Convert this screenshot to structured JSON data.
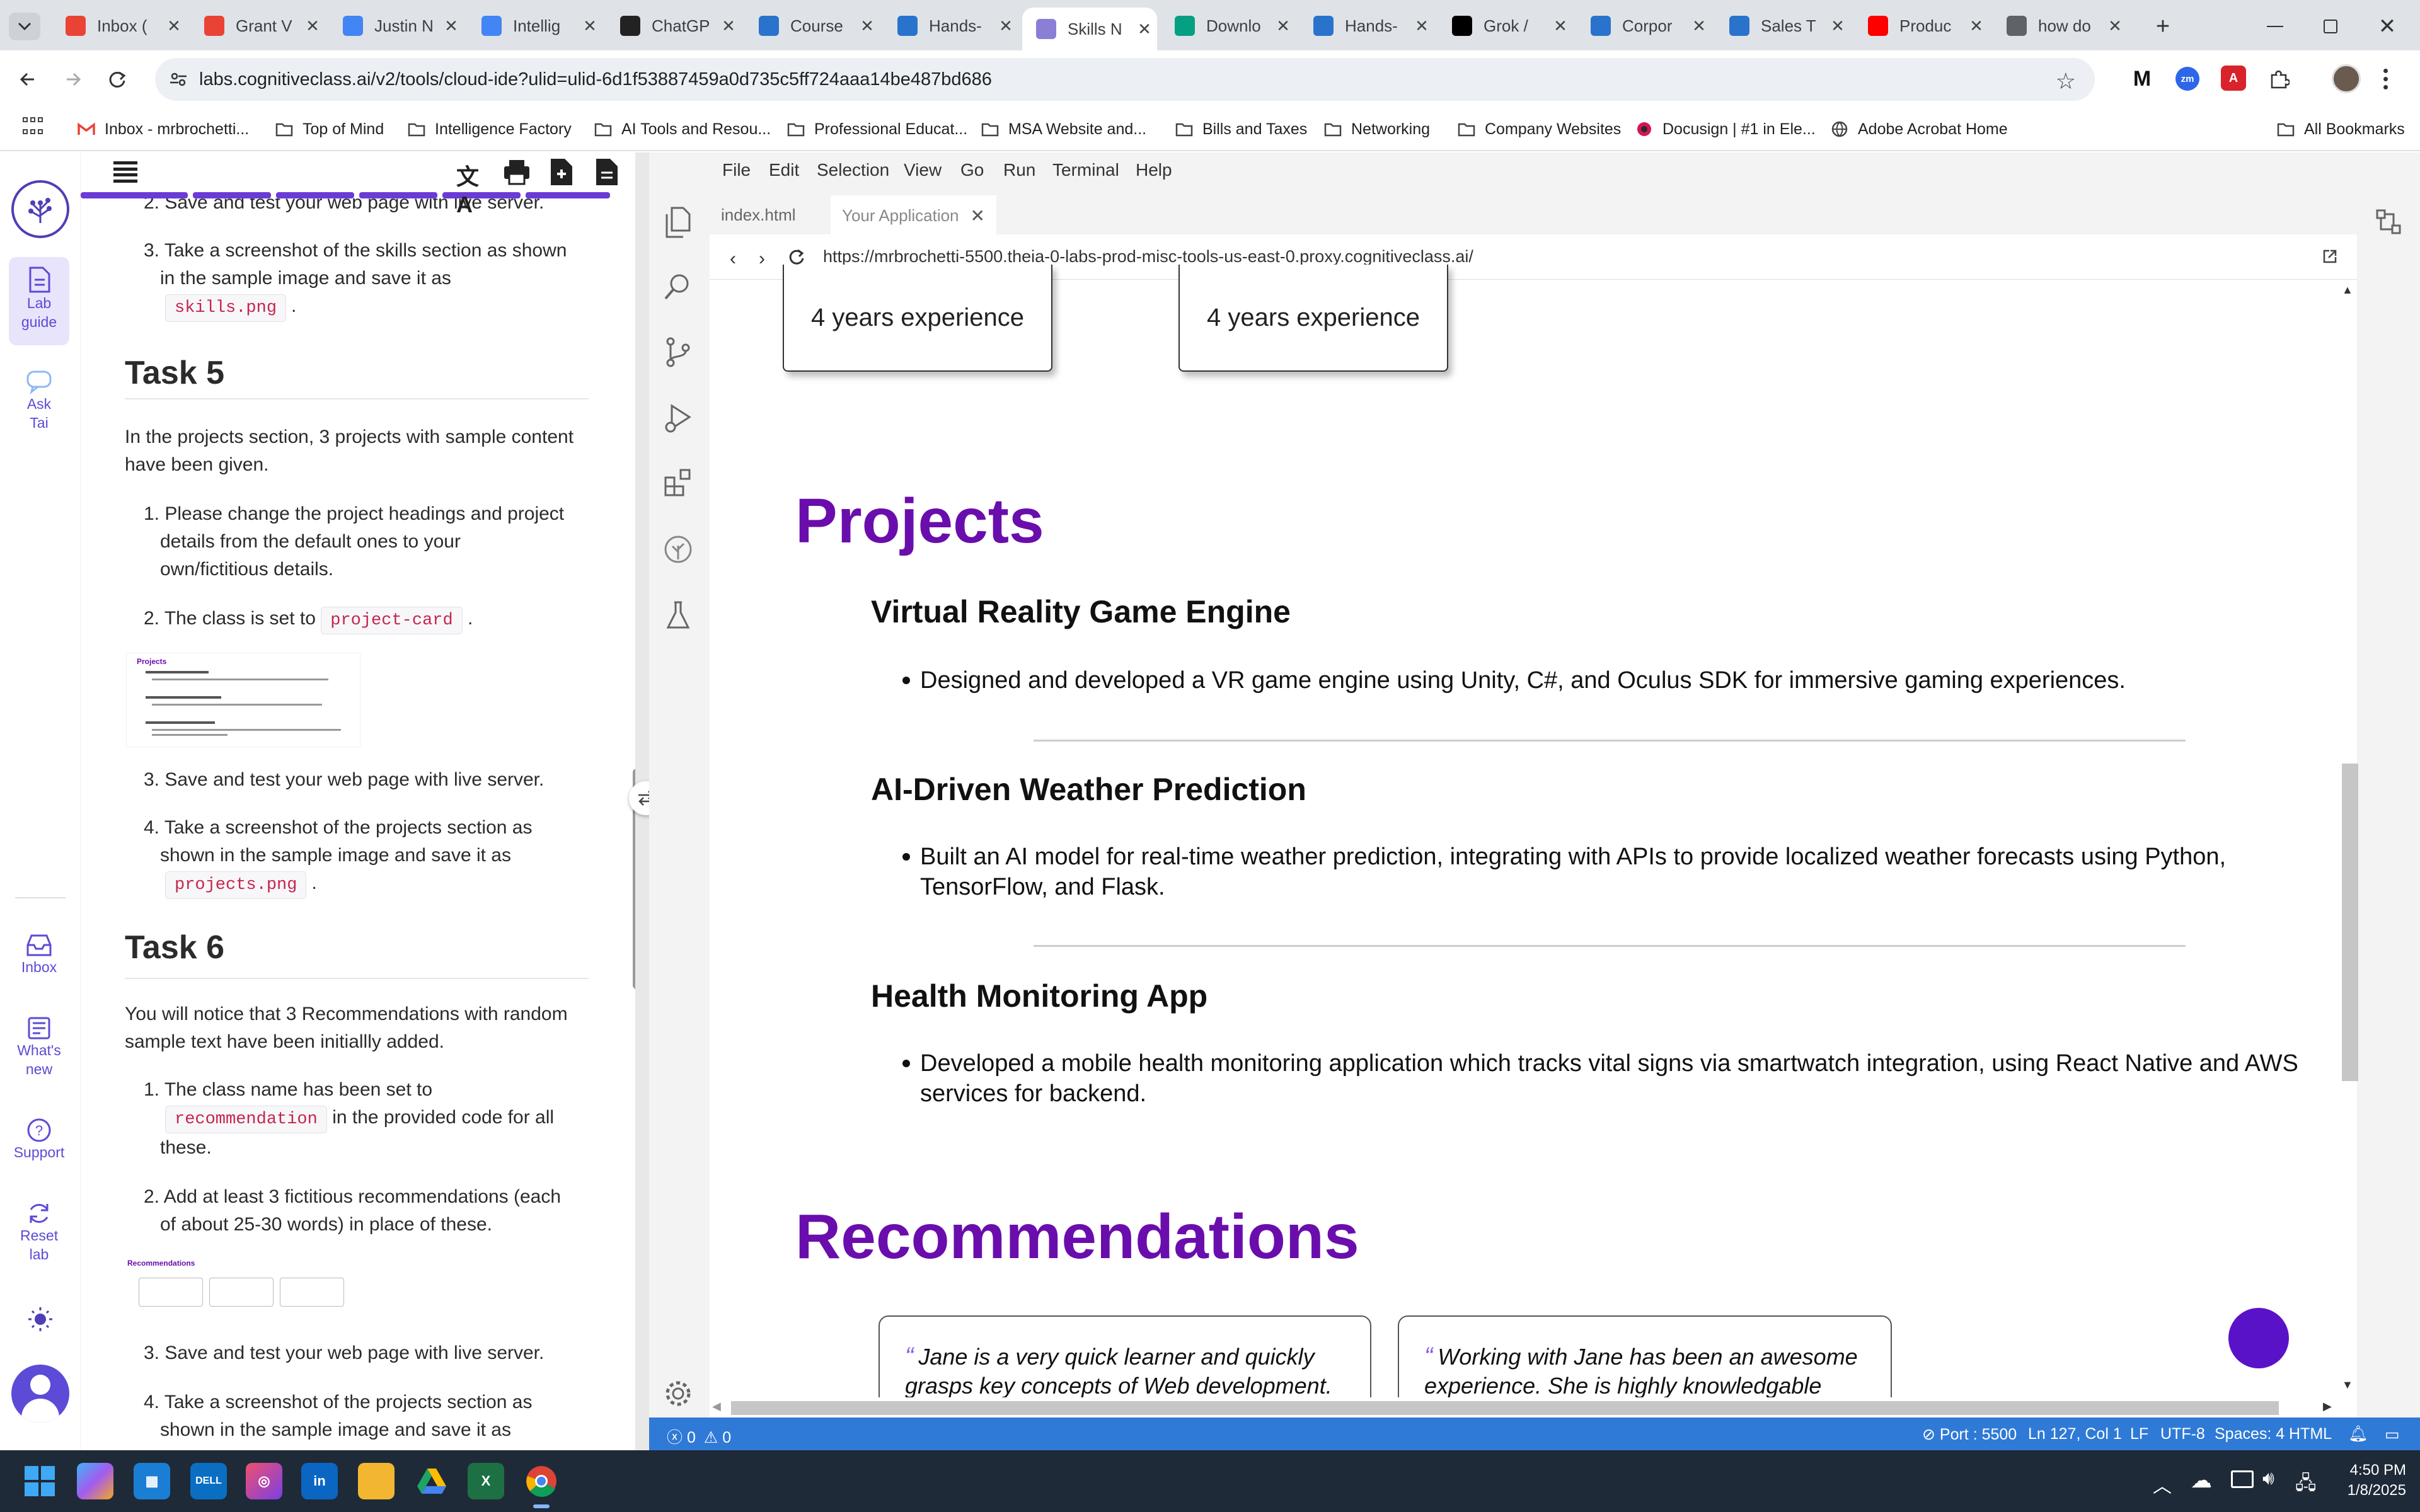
{
  "browser": {
    "tabs": [
      {
        "title": "Inbox (",
        "icon": "gmail-icon",
        "color": "#ea4335"
      },
      {
        "title": "Grant V",
        "icon": "gmail-icon",
        "color": "#ea4335"
      },
      {
        "title": "Justin N",
        "icon": "docs-icon",
        "color": "#4285f4"
      },
      {
        "title": "Intellig",
        "icon": "slides-icon",
        "color": "#4285f4"
      },
      {
        "title": "ChatGP",
        "icon": "openai-icon",
        "color": "#222222"
      },
      {
        "title": "Course",
        "icon": "coursera-icon",
        "color": "#2a73cc"
      },
      {
        "title": "Hands-",
        "icon": "coursera-icon",
        "color": "#2a73cc"
      },
      {
        "title": "Skills N",
        "icon": "theia-icon",
        "color": "#8a7fd6"
      },
      {
        "title": "Downlo",
        "icon": "pexels-icon",
        "color": "#05a081"
      },
      {
        "title": "Hands-",
        "icon": "coursera-icon",
        "color": "#2a73cc"
      },
      {
        "title": "Grok / ",
        "icon": "x-icon",
        "color": "#000000"
      },
      {
        "title": "Corpor",
        "icon": "coursera-icon",
        "color": "#2a73cc"
      },
      {
        "title": "Sales T",
        "icon": "coursera-icon",
        "color": "#2a73cc"
      },
      {
        "title": "Produc",
        "icon": "youtube-icon",
        "color": "#ff0000"
      },
      {
        "title": "how do",
        "icon": "globe-icon",
        "color": "#5f6368"
      }
    ],
    "active_tab_index": 7,
    "url": "labs.cognitiveclass.ai/v2/tools/cloud-ide?ulid=ulid-6d1f53887459a0d735c5ff724aaa14be487bd686",
    "bookmarks": [
      {
        "label": "Inbox - mrbrochetti...",
        "icon": "gmail-icon"
      },
      {
        "label": "Top of Mind",
        "icon": "folder-icon"
      },
      {
        "label": "Intelligence Factory",
        "icon": "folder-icon"
      },
      {
        "label": "AI Tools and Resou...",
        "icon": "folder-icon"
      },
      {
        "label": "Professional Educat...",
        "icon": "folder-icon"
      },
      {
        "label": "MSA Website and...",
        "icon": "folder-icon"
      },
      {
        "label": "Bills and Taxes",
        "icon": "folder-icon"
      },
      {
        "label": "Networking",
        "icon": "folder-icon"
      },
      {
        "label": "Company Websites",
        "icon": "folder-icon"
      },
      {
        "label": "Docusign | #1 in Ele...",
        "icon": "docusign-icon"
      },
      {
        "label": "Adobe Acrobat Home",
        "icon": "globe-icon"
      }
    ],
    "all_bookmarks": "All Bookmarks"
  },
  "rail": {
    "lab_guide": "Lab guide",
    "ask_tai": "Ask Tai",
    "inbox": "Inbox",
    "whats_new": "What's new",
    "support": "Support",
    "reset_lab": "Reset lab"
  },
  "guide": {
    "step2_prev": "2. Save and test your web page with live server.",
    "step3_prev_a": "3. Take a screenshot of the skills section as shown",
    "step3_prev_b": "in the sample image and save it as",
    "skills_png": "skills.png",
    "task5_title": "Task 5",
    "task5_intro_a": "In the projects section, 3 projects with sample content",
    "task5_intro_b": "have been given.",
    "t5_1a": "1. Please change the project headings and project",
    "t5_1b": "details from the default ones to your",
    "t5_1c": "own/fictitious details.",
    "t5_2": "2. The class is set to",
    "project_card": "project-card",
    "thumb_projects_title": "Projects",
    "t5_3": "3. Save and test your web page with live server.",
    "t5_4a": "4. Take a screenshot of the projects section as",
    "t5_4b": "shown in the sample image and save it as",
    "projects_png": "projects.png",
    "task6_title": "Task 6",
    "task6_intro_a": "You will notice that 3 Recommendations with random",
    "task6_intro_b": "sample text have been initiallly added.",
    "t6_1a": "1. The class name has been set to",
    "recommendation_code": "recommendation",
    "t6_1b": "in the provided code for all",
    "t6_1c": "these.",
    "t6_2a": "2. Add at least 3 fictitious recommendations (each",
    "t6_2b": "of about 25-30 words) in place of these.",
    "thumb_rec_title": "Recommendations",
    "t6_3": "3. Save and test your web page with live server.",
    "t6_4a": "4. Take a screenshot of the projects section as",
    "t6_4b": "shown in the sample image and save it as"
  },
  "ide": {
    "menu": [
      "File",
      "Edit",
      "Selection",
      "View",
      "Go",
      "Run",
      "Terminal",
      "Help"
    ],
    "tabs": [
      "index.html",
      "Your Application"
    ],
    "preview_url": "https://mrbrochetti-5500.theia-0-labs-prod-misc-tools-us-east-0.proxy.cognitiveclass.ai/",
    "status": {
      "problems": "0",
      "warnings": "0",
      "port": "Port : 5500",
      "position": "Ln 127, Col 1",
      "eol": "LF",
      "encoding": "UTF-8",
      "spaces": "Spaces: 4",
      "language": "HTML"
    }
  },
  "page": {
    "exp_1": "4 years experience",
    "exp_2": "4 years experience",
    "projects_heading": "Projects",
    "projects": [
      {
        "title": "Virtual Reality Game Engine",
        "desc": "Designed and developed a VR game engine using Unity, C#, and Oculus SDK for immersive gaming experiences."
      },
      {
        "title": "AI-Driven Weather Prediction",
        "desc": "Built an AI model for real-time weather prediction, integrating with APIs to provide localized weather forecasts using Python, TensorFlow, and Flask."
      },
      {
        "title": "Health Monitoring App",
        "desc": "Developed a mobile health monitoring application which tracks vital signs via smartwatch integration, using React Native and AWS services for backend."
      }
    ],
    "recommendations_heading": "Recommendations",
    "recommendations": [
      "Jane is a very quick learner and quickly grasps key concepts of Web development.",
      "Working with Jane has been an awesome experience. She is highly knowledgable"
    ],
    "accent_color": "#6a0dad"
  },
  "taskbar": {
    "time": "4:50 PM",
    "date": "1/8/2025"
  }
}
